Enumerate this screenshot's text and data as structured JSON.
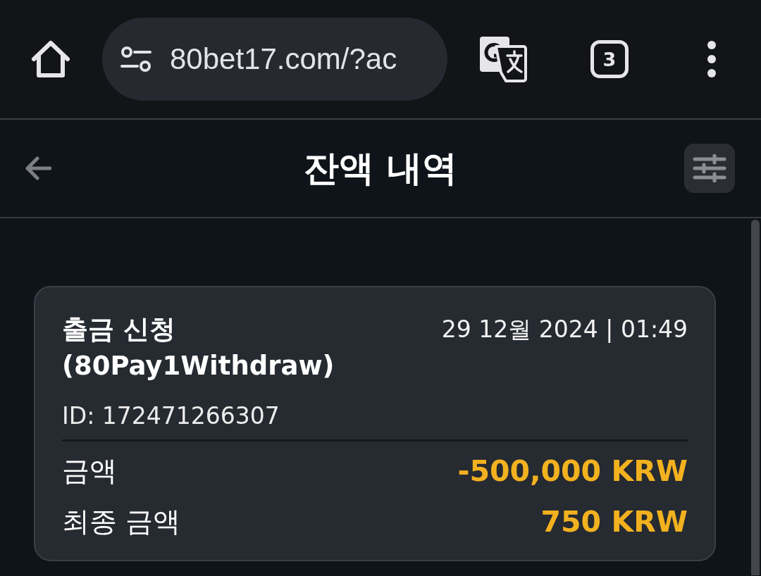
{
  "browser_toolbar": {
    "url": "80bet17.com/?ac",
    "tab_count": "3"
  },
  "header": {
    "title": "잔액 내역"
  },
  "transactions": [
    {
      "title": "출금 신청 (80Pay1Withdraw)",
      "datetime": "29 12월 2024 | 01:49",
      "id": "ID: 172471266307",
      "rows": [
        {
          "label": "금액",
          "value": "-500,000 KRW"
        },
        {
          "label": "최종 금액",
          "value": "750 KRW"
        }
      ]
    }
  ]
}
